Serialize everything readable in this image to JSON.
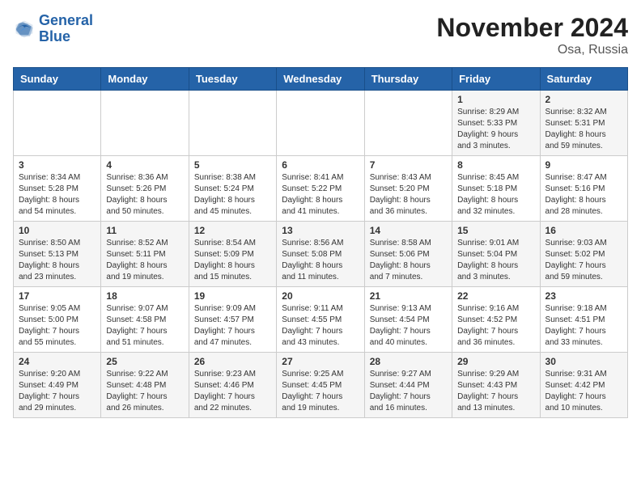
{
  "logo": {
    "line1": "General",
    "line2": "Blue"
  },
  "title": "November 2024",
  "location": "Osa, Russia",
  "days_of_week": [
    "Sunday",
    "Monday",
    "Tuesday",
    "Wednesday",
    "Thursday",
    "Friday",
    "Saturday"
  ],
  "weeks": [
    [
      {
        "day": "",
        "content": ""
      },
      {
        "day": "",
        "content": ""
      },
      {
        "day": "",
        "content": ""
      },
      {
        "day": "",
        "content": ""
      },
      {
        "day": "",
        "content": ""
      },
      {
        "day": "1",
        "content": "Sunrise: 8:29 AM\nSunset: 5:33 PM\nDaylight: 9 hours\nand 3 minutes."
      },
      {
        "day": "2",
        "content": "Sunrise: 8:32 AM\nSunset: 5:31 PM\nDaylight: 8 hours\nand 59 minutes."
      }
    ],
    [
      {
        "day": "3",
        "content": "Sunrise: 8:34 AM\nSunset: 5:28 PM\nDaylight: 8 hours\nand 54 minutes."
      },
      {
        "day": "4",
        "content": "Sunrise: 8:36 AM\nSunset: 5:26 PM\nDaylight: 8 hours\nand 50 minutes."
      },
      {
        "day": "5",
        "content": "Sunrise: 8:38 AM\nSunset: 5:24 PM\nDaylight: 8 hours\nand 45 minutes."
      },
      {
        "day": "6",
        "content": "Sunrise: 8:41 AM\nSunset: 5:22 PM\nDaylight: 8 hours\nand 41 minutes."
      },
      {
        "day": "7",
        "content": "Sunrise: 8:43 AM\nSunset: 5:20 PM\nDaylight: 8 hours\nand 36 minutes."
      },
      {
        "day": "8",
        "content": "Sunrise: 8:45 AM\nSunset: 5:18 PM\nDaylight: 8 hours\nand 32 minutes."
      },
      {
        "day": "9",
        "content": "Sunrise: 8:47 AM\nSunset: 5:16 PM\nDaylight: 8 hours\nand 28 minutes."
      }
    ],
    [
      {
        "day": "10",
        "content": "Sunrise: 8:50 AM\nSunset: 5:13 PM\nDaylight: 8 hours\nand 23 minutes."
      },
      {
        "day": "11",
        "content": "Sunrise: 8:52 AM\nSunset: 5:11 PM\nDaylight: 8 hours\nand 19 minutes."
      },
      {
        "day": "12",
        "content": "Sunrise: 8:54 AM\nSunset: 5:09 PM\nDaylight: 8 hours\nand 15 minutes."
      },
      {
        "day": "13",
        "content": "Sunrise: 8:56 AM\nSunset: 5:08 PM\nDaylight: 8 hours\nand 11 minutes."
      },
      {
        "day": "14",
        "content": "Sunrise: 8:58 AM\nSunset: 5:06 PM\nDaylight: 8 hours\nand 7 minutes."
      },
      {
        "day": "15",
        "content": "Sunrise: 9:01 AM\nSunset: 5:04 PM\nDaylight: 8 hours\nand 3 minutes."
      },
      {
        "day": "16",
        "content": "Sunrise: 9:03 AM\nSunset: 5:02 PM\nDaylight: 7 hours\nand 59 minutes."
      }
    ],
    [
      {
        "day": "17",
        "content": "Sunrise: 9:05 AM\nSunset: 5:00 PM\nDaylight: 7 hours\nand 55 minutes."
      },
      {
        "day": "18",
        "content": "Sunrise: 9:07 AM\nSunset: 4:58 PM\nDaylight: 7 hours\nand 51 minutes."
      },
      {
        "day": "19",
        "content": "Sunrise: 9:09 AM\nSunset: 4:57 PM\nDaylight: 7 hours\nand 47 minutes."
      },
      {
        "day": "20",
        "content": "Sunrise: 9:11 AM\nSunset: 4:55 PM\nDaylight: 7 hours\nand 43 minutes."
      },
      {
        "day": "21",
        "content": "Sunrise: 9:13 AM\nSunset: 4:54 PM\nDaylight: 7 hours\nand 40 minutes."
      },
      {
        "day": "22",
        "content": "Sunrise: 9:16 AM\nSunset: 4:52 PM\nDaylight: 7 hours\nand 36 minutes."
      },
      {
        "day": "23",
        "content": "Sunrise: 9:18 AM\nSunset: 4:51 PM\nDaylight: 7 hours\nand 33 minutes."
      }
    ],
    [
      {
        "day": "24",
        "content": "Sunrise: 9:20 AM\nSunset: 4:49 PM\nDaylight: 7 hours\nand 29 minutes."
      },
      {
        "day": "25",
        "content": "Sunrise: 9:22 AM\nSunset: 4:48 PM\nDaylight: 7 hours\nand 26 minutes."
      },
      {
        "day": "26",
        "content": "Sunrise: 9:23 AM\nSunset: 4:46 PM\nDaylight: 7 hours\nand 22 minutes."
      },
      {
        "day": "27",
        "content": "Sunrise: 9:25 AM\nSunset: 4:45 PM\nDaylight: 7 hours\nand 19 minutes."
      },
      {
        "day": "28",
        "content": "Sunrise: 9:27 AM\nSunset: 4:44 PM\nDaylight: 7 hours\nand 16 minutes."
      },
      {
        "day": "29",
        "content": "Sunrise: 9:29 AM\nSunset: 4:43 PM\nDaylight: 7 hours\nand 13 minutes."
      },
      {
        "day": "30",
        "content": "Sunrise: 9:31 AM\nSunset: 4:42 PM\nDaylight: 7 hours\nand 10 minutes."
      }
    ]
  ]
}
